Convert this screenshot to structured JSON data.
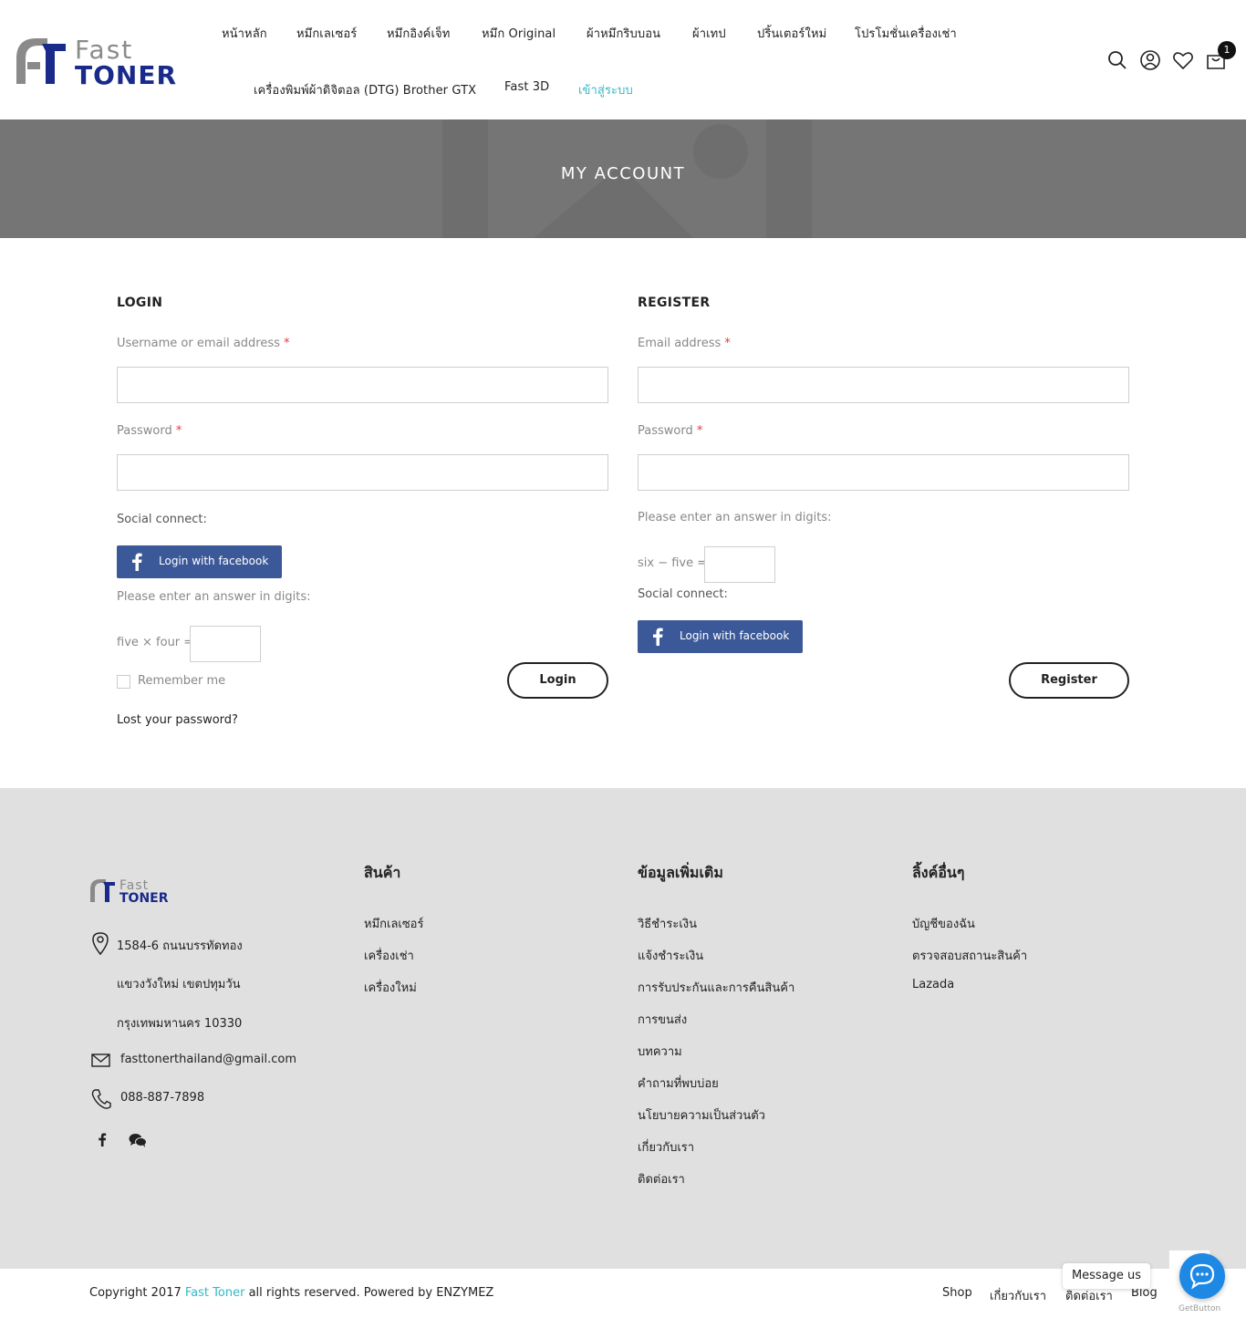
{
  "header": {
    "logo": {
      "line1": "Fast",
      "line2": "TONER",
      "brand_blue": "#1a2a8a",
      "brand_gray": "#8a8a8a"
    },
    "nav": [
      "หน้าหลัก",
      "หมึกเลเซอร์",
      "หมึกอิงค์เจ็ท",
      "หมึก Original",
      "ผ้าหมึกริบบอน",
      "ผ้าเทป",
      "ปริ้นเตอร์ใหม่",
      "โปรโมชั่นเครื่องเช่า",
      "เครื่องพิมพ์ผ้าดิจิตอล (DTG) Brother GTX",
      "Fast 3D",
      "เข้าสู่ระบบ"
    ],
    "icons": [
      "search-icon",
      "user-icon",
      "heart-icon",
      "cart-icon"
    ],
    "cart_count": "1",
    "active_color": "#35b8c6"
  },
  "banner": {
    "title": "MY ACCOUNT",
    "background": "#757575"
  },
  "login": {
    "title": "LOGIN",
    "username_label": "Username or email address",
    "password_label": "Password",
    "required_mark": "*",
    "social_label": "Social connect:",
    "facebook_button": "Login with facebook",
    "captcha_prompt": "Please enter an answer in digits:",
    "captcha_question": "five × four =",
    "remember_label": "Remember me",
    "submit_label": "Login",
    "lost_password": "Lost your password?"
  },
  "register": {
    "title": "REGISTER",
    "email_label": "Email address",
    "password_label": "Password",
    "required_mark": "*",
    "captcha_prompt": "Please enter an answer in digits:",
    "captcha_question": "six − five =",
    "social_label": "Social connect:",
    "facebook_button": "Login with facebook",
    "submit_label": "Register"
  },
  "footer": {
    "logo": {
      "line1": "Fast",
      "line2": "TONER"
    },
    "address_lines": [
      "1584-6 ถนนบรรทัดทอง",
      "แขวงวังใหม่ เขตปทุมวัน",
      "กรุงเทพมหานคร 10330"
    ],
    "email": "fasttonerthailand@gmail.com",
    "phone": "088-887-7898",
    "columns": [
      {
        "title": "สินค้า",
        "links": [
          "หมึกเลเซอร์",
          "เครื่องเช่า",
          "เครื่องใหม่"
        ]
      },
      {
        "title": "ข้อมูลเพิ่มเติม",
        "links": [
          "วิธีชำระเงิน",
          "แจ้งชำระเงิน",
          "การรับประกันและการคืนสินค้า",
          "การขนส่ง",
          "บทความ",
          "คำถามที่พบบ่อย",
          "นโยบายความเป็นส่วนตัว",
          "เกี่ยวกับเรา",
          "ติดต่อเรา"
        ]
      },
      {
        "title": "ลิ้งค์อื่นๆ",
        "links": [
          "บัญชีของฉัน",
          "ตรวจสอบสถานะสินค้า",
          "Lazada"
        ]
      }
    ],
    "social_icons": [
      "facebook-icon",
      "wechat-icon"
    ],
    "background": "#e0e0e0"
  },
  "bottom": {
    "copyright_prefix": "Copyright 2017",
    "brand": "Fast Toner",
    "copyright_suffix": "all rights reserved. Powered by ENZYMEZ",
    "links": [
      "Shop",
      "เกี่ยวกับเรา",
      "ติดต่อเรา",
      "Blog"
    ]
  },
  "chat_widget": {
    "bubble": "Message us",
    "credit": "GetButton",
    "fab_color": "#1e88e5"
  },
  "facebook_color": "#3b5998"
}
